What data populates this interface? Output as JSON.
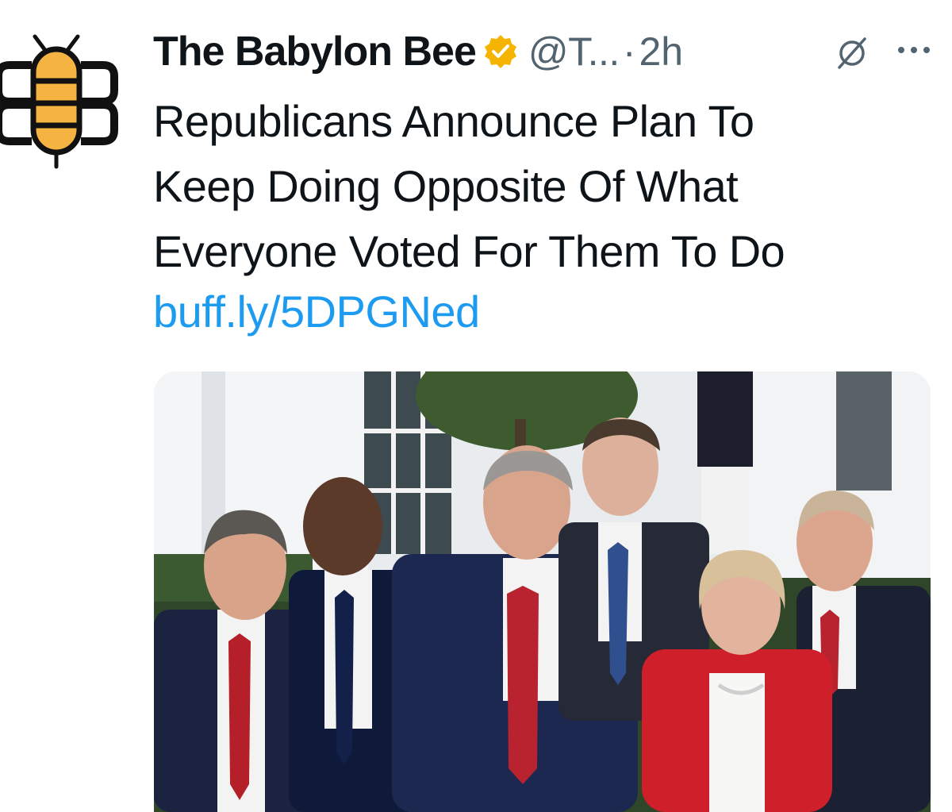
{
  "account": {
    "display_name": "The Babylon Bee",
    "handle": "@T...",
    "separator": "·",
    "time": "2h",
    "verified_icon": "verified-gold-badge-icon",
    "avatar_icon": "babylon-bee-logo-icon",
    "verified_color": "#f4b400"
  },
  "tweet": {
    "text_lines": [
      "Republicans Announce Plan To",
      "Keep Doing Opposite Of What",
      "Everyone Voted For Them To Do"
    ],
    "link": "buff.ly/5DPGNed",
    "link_color": "#1d9bf0"
  },
  "actions": {
    "grok_icon": "grok-slash-icon",
    "more_icon": "more-options-icon"
  },
  "media": {
    "description_icon": "press-conference-photo"
  }
}
